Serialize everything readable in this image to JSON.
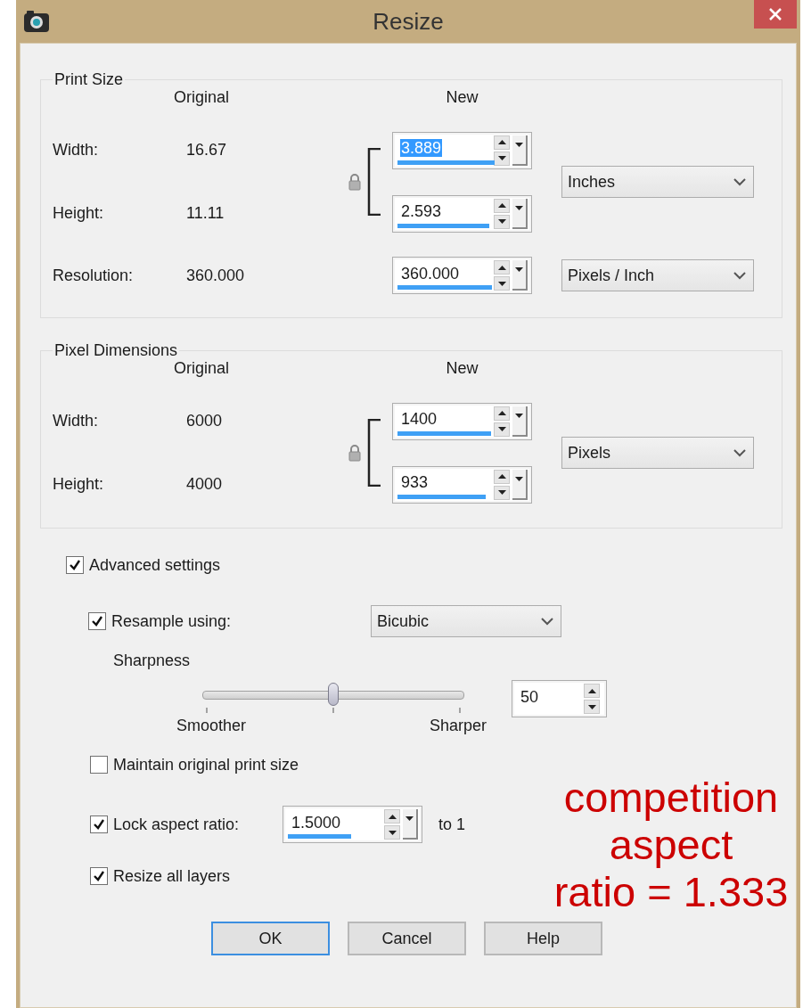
{
  "window": {
    "title": "Resize"
  },
  "print_size": {
    "title": "Print Size",
    "original_header": "Original",
    "new_header": "New",
    "locked": true,
    "unit": "Inches",
    "rows": [
      {
        "label": "Width:",
        "original": "16.67",
        "value": "3.889",
        "highlighted": true,
        "level": 0.77
      },
      {
        "label": "Height:",
        "original": "11.11",
        "value": "2.593",
        "highlighted": false,
        "level": 0.73
      }
    ],
    "resolution": {
      "label": "Resolution:",
      "original": "360.000",
      "value": "360.000",
      "highlighted": false,
      "level": 0.75,
      "unit": "Pixels / Inch"
    }
  },
  "pixel_dimensions": {
    "title": "Pixel Dimensions",
    "original_header": "Original",
    "new_header": "New",
    "locked": true,
    "unit": "Pixels",
    "rows": [
      {
        "label": "Width:",
        "original": "6000",
        "value": "1400",
        "highlighted": false,
        "level": 0.74
      },
      {
        "label": "Height:",
        "original": "4000",
        "value": "933",
        "highlighted": false,
        "level": 0.7
      }
    ]
  },
  "advanced_settings": {
    "label": "Advanced settings",
    "checked": true
  },
  "resample": {
    "label": "Resample using:",
    "checked": true,
    "method": "Bicubic"
  },
  "sharpness": {
    "label": "Sharpness",
    "level": 0.5,
    "min_label": "Smoother",
    "max_label": "Sharper",
    "value": "50"
  },
  "maintain_print_size": {
    "label": "Maintain original print size",
    "checked": false
  },
  "lock_aspect_ratio": {
    "label": "Lock aspect ratio:",
    "checked": true,
    "value": "1.5000",
    "level": 0.52,
    "suffix": "to 1"
  },
  "resize_all_layers": {
    "label": "Resize all layers",
    "checked": true
  },
  "buttons": [
    {
      "label": "OK",
      "default": true
    },
    {
      "label": "Cancel",
      "default": false
    },
    {
      "label": "Help",
      "default": false
    }
  ],
  "annotation": {
    "lines": [
      "competition",
      "aspect",
      "ratio = 1.333"
    ]
  }
}
